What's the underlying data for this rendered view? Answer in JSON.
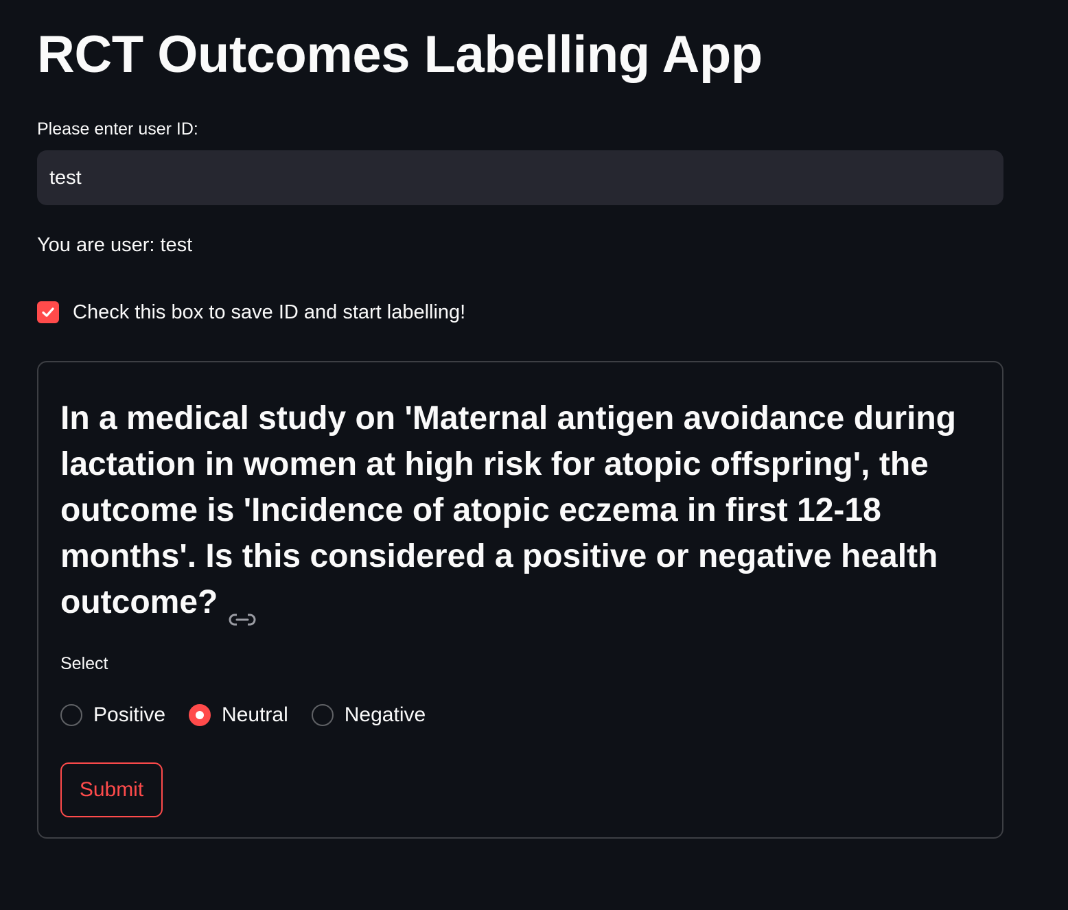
{
  "app": {
    "title": "RCT Outcomes Labelling App"
  },
  "user_input": {
    "label": "Please enter user ID:",
    "value": "test",
    "placeholder": ""
  },
  "user_status": {
    "text": "You are user: test"
  },
  "save_checkbox": {
    "label": "Check this box to save ID and start labelling!",
    "checked": true
  },
  "form": {
    "question": "In a medical study on 'Maternal antigen avoidance during lactation in women at high risk for atopic offspring', the outcome is 'Incidence of atopic eczema in first 12-18 months'. Is this considered a positive or negative health outcome?",
    "select_label": "Select",
    "options": [
      {
        "label": "Positive",
        "selected": false
      },
      {
        "label": "Neutral",
        "selected": true
      },
      {
        "label": "Negative",
        "selected": false
      }
    ],
    "submit_label": "Submit"
  },
  "colors": {
    "background": "#0e1117",
    "input_background": "#262730",
    "accent": "#ff4b4b",
    "text": "#fafafa"
  },
  "icons": {
    "checkbox": "check-icon",
    "heading_anchor": "link-icon"
  }
}
